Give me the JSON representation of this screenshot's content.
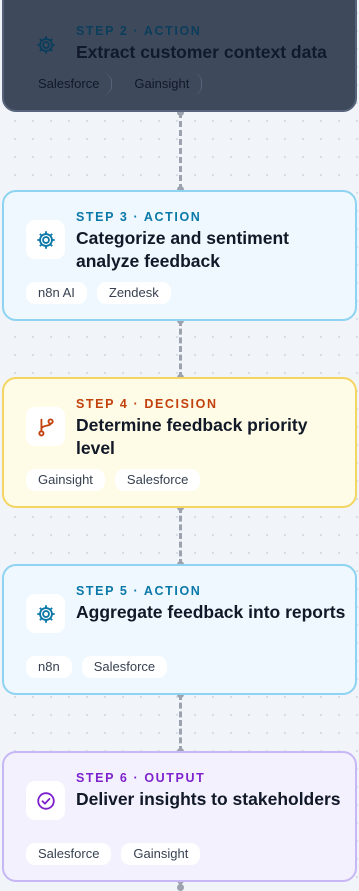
{
  "steps": [
    {
      "label": "STEP 2 · ACTION",
      "title": "Extract customer context data",
      "tags": [
        "Salesforce",
        "Gainsight"
      ],
      "icon": "gear-icon",
      "kind": "action"
    },
    {
      "label": "STEP 3 · ACTION",
      "title": "Categorize and sentiment analyze feedback",
      "tags": [
        "n8n AI",
        "Zendesk"
      ],
      "icon": "gear-icon",
      "kind": "action"
    },
    {
      "label": "STEP 4 · DECISION",
      "title": "Determine feedback priority level",
      "tags": [
        "Gainsight",
        "Salesforce"
      ],
      "icon": "branch-icon",
      "kind": "decision"
    },
    {
      "label": "STEP 5 · ACTION",
      "title": "Aggregate feedback into reports",
      "tags": [
        "n8n",
        "Salesforce"
      ],
      "icon": "gear-icon",
      "kind": "action"
    },
    {
      "label": "STEP 6 · OUTPUT",
      "title": "Deliver insights to stakeholders",
      "tags": [
        "Salesforce",
        "Gainsight"
      ],
      "icon": "check-circle-icon",
      "kind": "output"
    }
  ],
  "colors": {
    "action_border": "#8fd3f2",
    "decision_border": "#f5d562",
    "output_border": "#c7b8f5",
    "action_accent": "#0a78a8",
    "decision_accent": "#c2410c",
    "output_accent": "#7e22ce"
  }
}
